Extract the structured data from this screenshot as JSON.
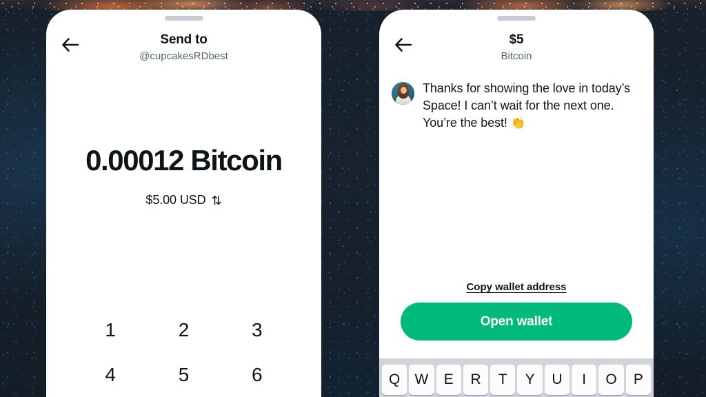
{
  "background": {
    "base_color": "#15202b",
    "accent_dot_color": "#3c87c3",
    "nebula_color": "#c66c3c"
  },
  "left_panel": {
    "grabber": "drag-handle",
    "nav": {
      "back_icon": "arrow-left-icon",
      "title": "Send to",
      "subtitle": "@cupcakesRDbest"
    },
    "amount": {
      "crypto": "0.00012 Bitcoin",
      "fiat": "$5.00 USD",
      "swap_icon": "⇅"
    },
    "keypad": [
      "1",
      "2",
      "3",
      "4",
      "5",
      "6"
    ]
  },
  "right_panel": {
    "grabber": "drag-handle",
    "nav": {
      "back_icon": "arrow-left-icon",
      "title": "$5",
      "subtitle": "Bitcoin"
    },
    "message": {
      "avatar": "user-avatar",
      "text": "Thanks for showing the love in today’s Space! I can’t wait for the next one. You’re the best! ",
      "emoji": "👏"
    },
    "actions": {
      "copy_link": "Copy wallet address",
      "cta_label": "Open wallet",
      "cta_color": "#00ba7c"
    },
    "keyboard": {
      "row": [
        "Q",
        "W",
        "E",
        "R",
        "T",
        "Y",
        "U",
        "I",
        "O",
        "P"
      ]
    }
  }
}
